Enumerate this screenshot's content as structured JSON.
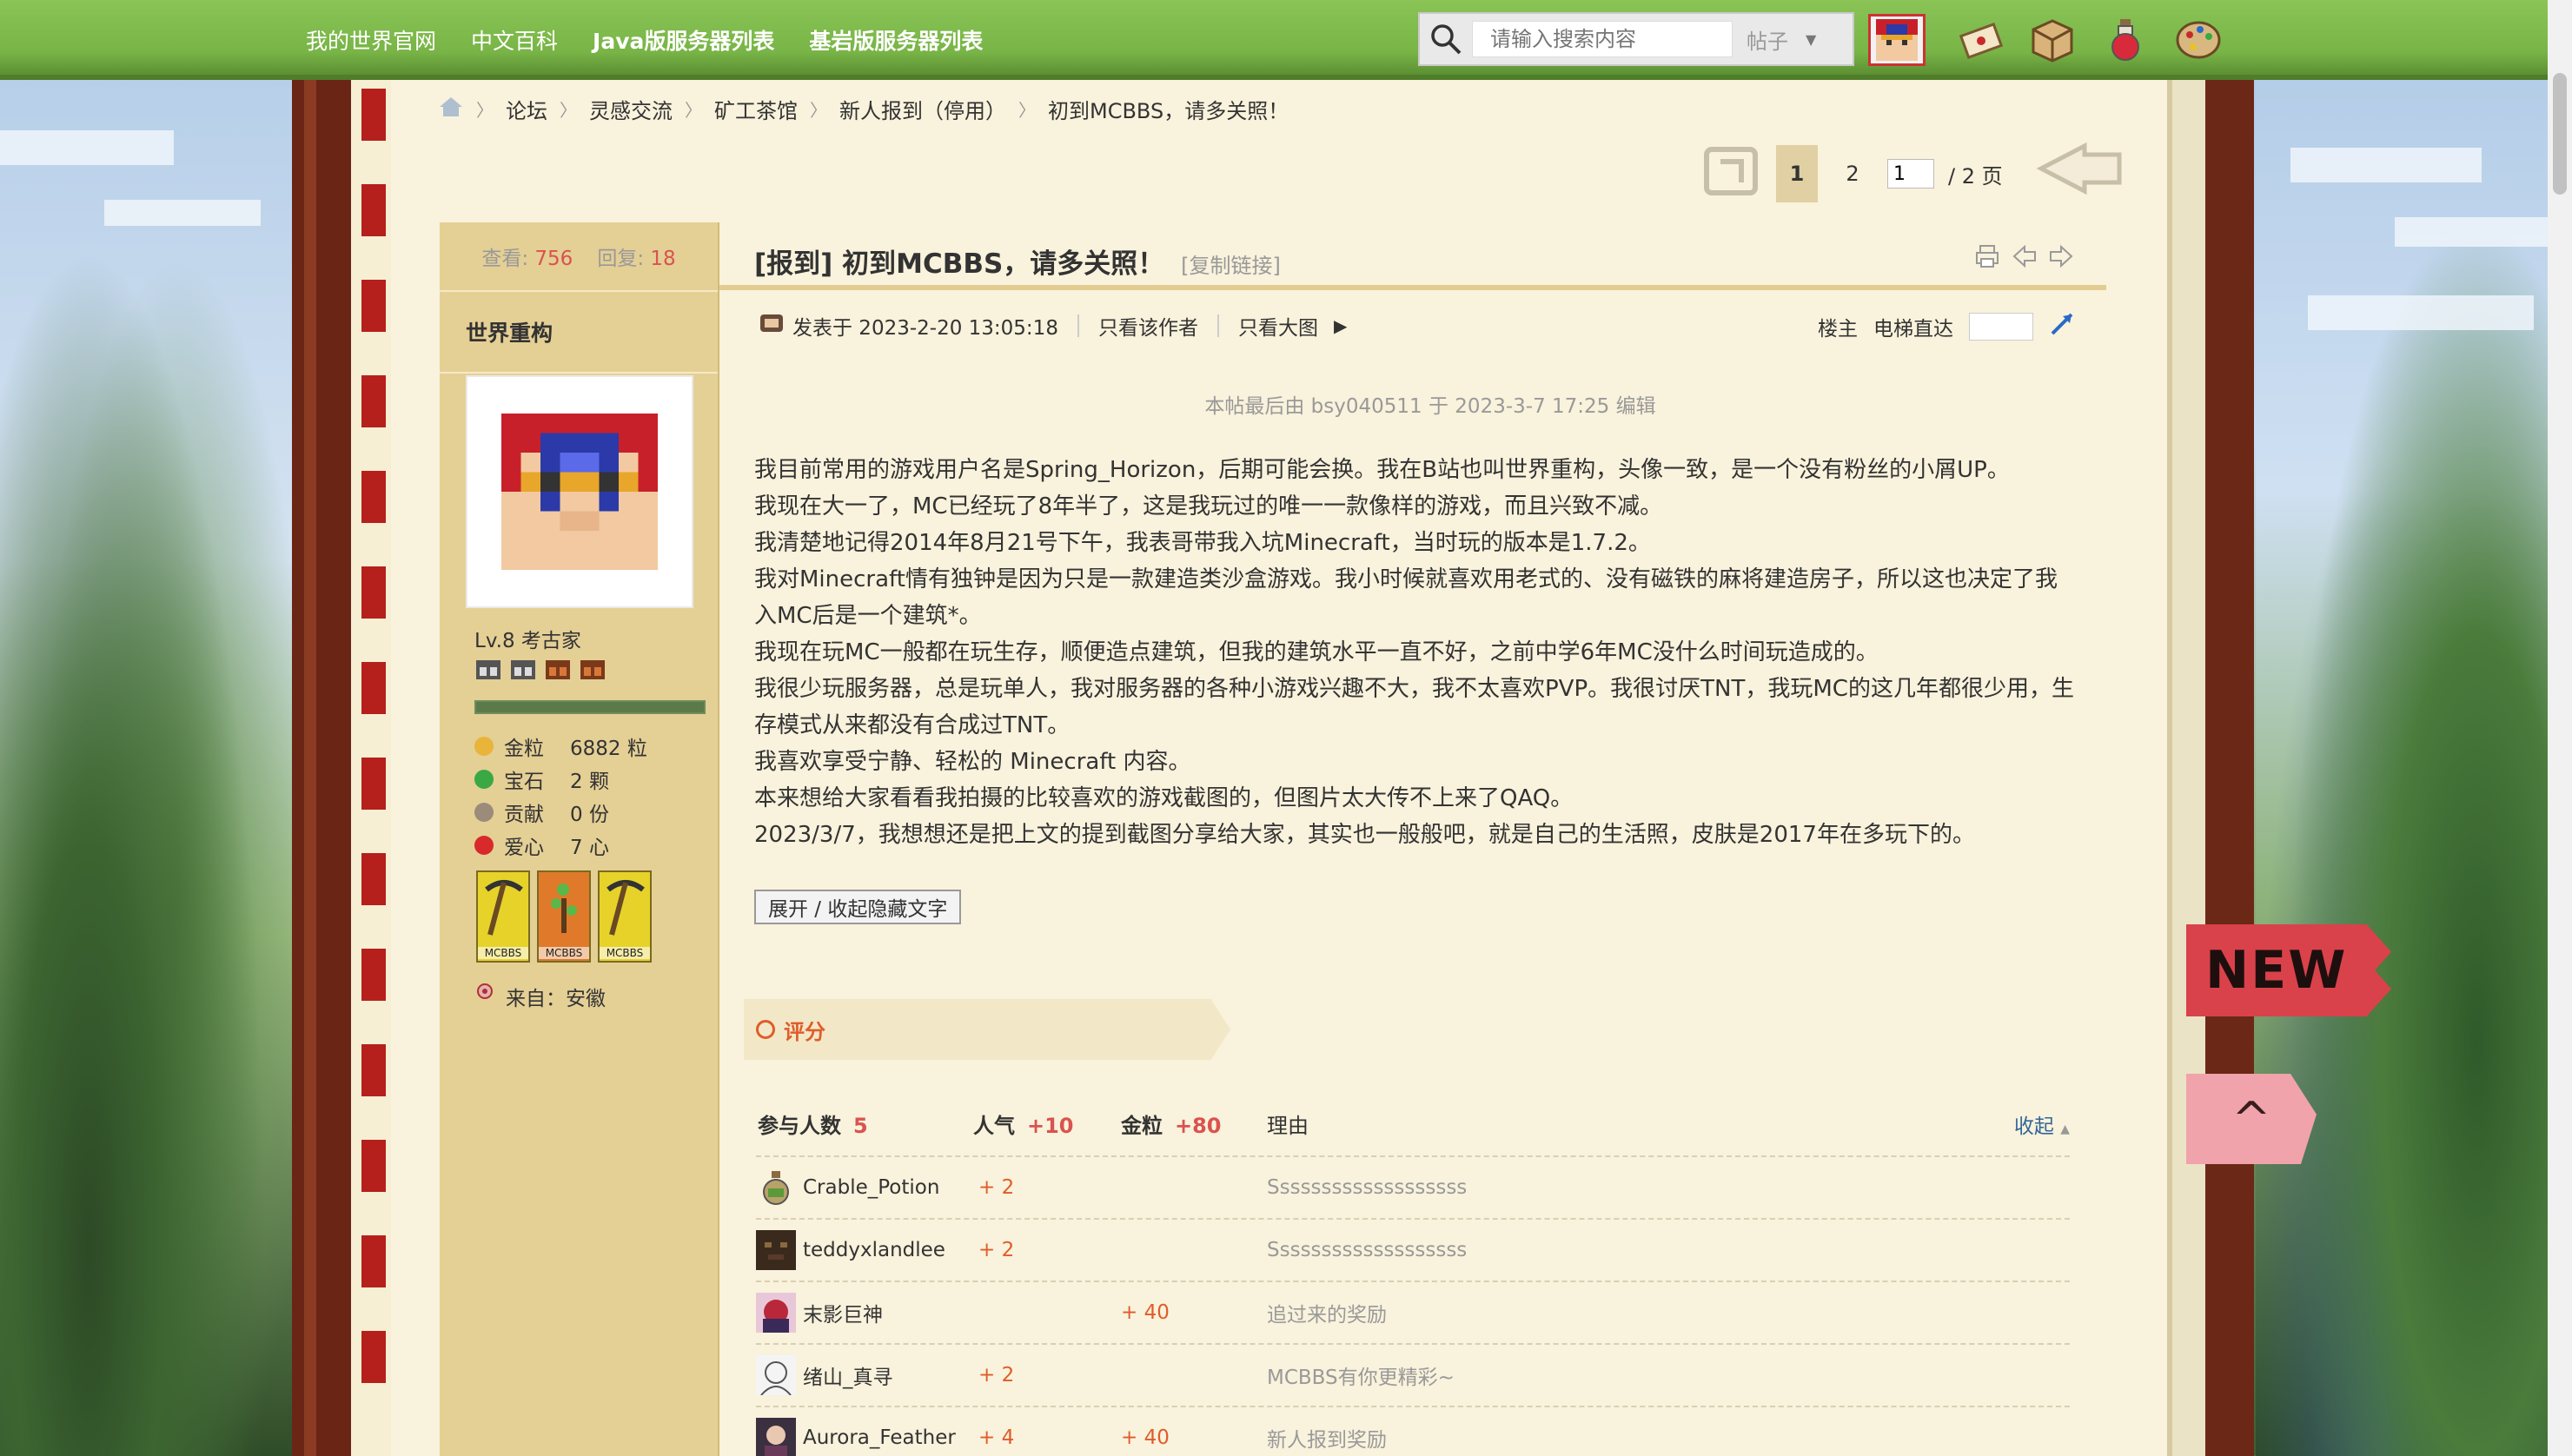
{
  "nav": {
    "links": [
      "我的世界官网",
      "中文百科",
      "Java版服务器列表",
      "基岩版服务器列表"
    ],
    "search_placeholder": "请输入搜索内容",
    "search_type": "帖子"
  },
  "breadcrumb": [
    "论坛",
    "灵感交流",
    "矿工茶馆",
    "新人报到（停用）",
    "初到MCBBS，请多关照！"
  ],
  "pager": {
    "current": "1",
    "next": "2",
    "input_value": "1",
    "total": "/ 2 页"
  },
  "stats": {
    "views_label": "查看:",
    "views": "756",
    "replies_label": "回复:",
    "replies": "18"
  },
  "author": {
    "name": "世界重构",
    "level": "Lv.8 考古家",
    "credits": [
      {
        "label": "金粒",
        "value": "6882 粒",
        "color": "#e8b43a"
      },
      {
        "label": "宝石",
        "value": "2 颗",
        "color": "#3aa845"
      },
      {
        "label": "贡献",
        "value": "0 份",
        "color": "#9c8a7a"
      },
      {
        "label": "爱心",
        "value": "7 心",
        "color": "#d82a2a"
      }
    ],
    "badges": [
      "MCBBS",
      "MCBBS",
      "MCBBS"
    ],
    "from": "来自：安徽"
  },
  "post": {
    "title": "[报到] 初到MCBBS，请多关照！",
    "copy_link": "[复制链接]",
    "posted": "发表于 2023-2-20 13:05:18",
    "only_author": "只看该作者",
    "only_big_images": "只看大图",
    "floor": "楼主",
    "goto": "电梯直达",
    "edited": "本帖最后由 bsy040511 于 2023-3-7 17:25 编辑",
    "paragraphs": [
      "我目前常用的游戏用户名是Spring_Horizon，后期可能会换。我在B站也叫世界重构，头像一致，是一个没有粉丝的小屑UP。",
      "我现在大一了，MC已经玩了8年半了，这是我玩过的唯一一款像样的游戏，而且兴致不减。",
      "我清楚地记得2014年8月21号下午，我表哥带我入坑Minecraft，当时玩的版本是1.7.2。",
      "我对Minecraft情有独钟是因为只是一款建造类沙盒游戏。我小时候就喜欢用老式的、没有磁铁的麻将建造房子，所以这也决定了我入MC后是一个建筑*。",
      "我现在玩MC一般都在玩生存，顺便造点建筑，但我的建筑水平一直不好，之前中学6年MC没什么时间玩造成的。",
      "我很少玩服务器，总是玩单人，我对服务器的各种小游戏兴趣不大，我不太喜欢PVP。我很讨厌TNT，我玩MC的这几年都很少用，生存模式从来都没有合成过TNT。",
      "我喜欢享受宁静、轻松的 Minecraft 内容。",
      "本来想给大家看看我拍摄的比较喜欢的游戏截图的，但图片太大传不上来了QAQ。",
      "2023/3/7，我想想还是把上文的提到截图分享给大家，其实也一般般吧，就是自己的生活照，皮肤是2017年在多玩下的。"
    ],
    "toggle": "展开 / 收起隐藏文字"
  },
  "rating": {
    "tab": "评分",
    "participants_label": "参与人数",
    "participants": "5",
    "pop_label": "人气",
    "pop_total": "+10",
    "gold_label": "金粒",
    "gold_total": "+80",
    "reason_label": "理由",
    "collapse": "收起",
    "rows": [
      {
        "user": "Crable_Potion",
        "pop": "+ 2",
        "gold": "",
        "reason": "Sssssssssssssssssss"
      },
      {
        "user": "teddyxlandlee",
        "pop": "+ 2",
        "gold": "",
        "reason": "Sssssssssssssssssss"
      },
      {
        "user": "末影巨神",
        "pop": "",
        "gold": "+ 40",
        "reason": "追过来的奖励"
      },
      {
        "user": "绪山_真寻",
        "pop": "+ 2",
        "gold": "",
        "reason": "MCBBS有你更精彩~"
      },
      {
        "user": "Aurora_Feather",
        "pop": "+ 4",
        "gold": "+ 40",
        "reason": "新人报到奖励"
      }
    ]
  },
  "flags": {
    "new": "NEW",
    "top": "^"
  }
}
